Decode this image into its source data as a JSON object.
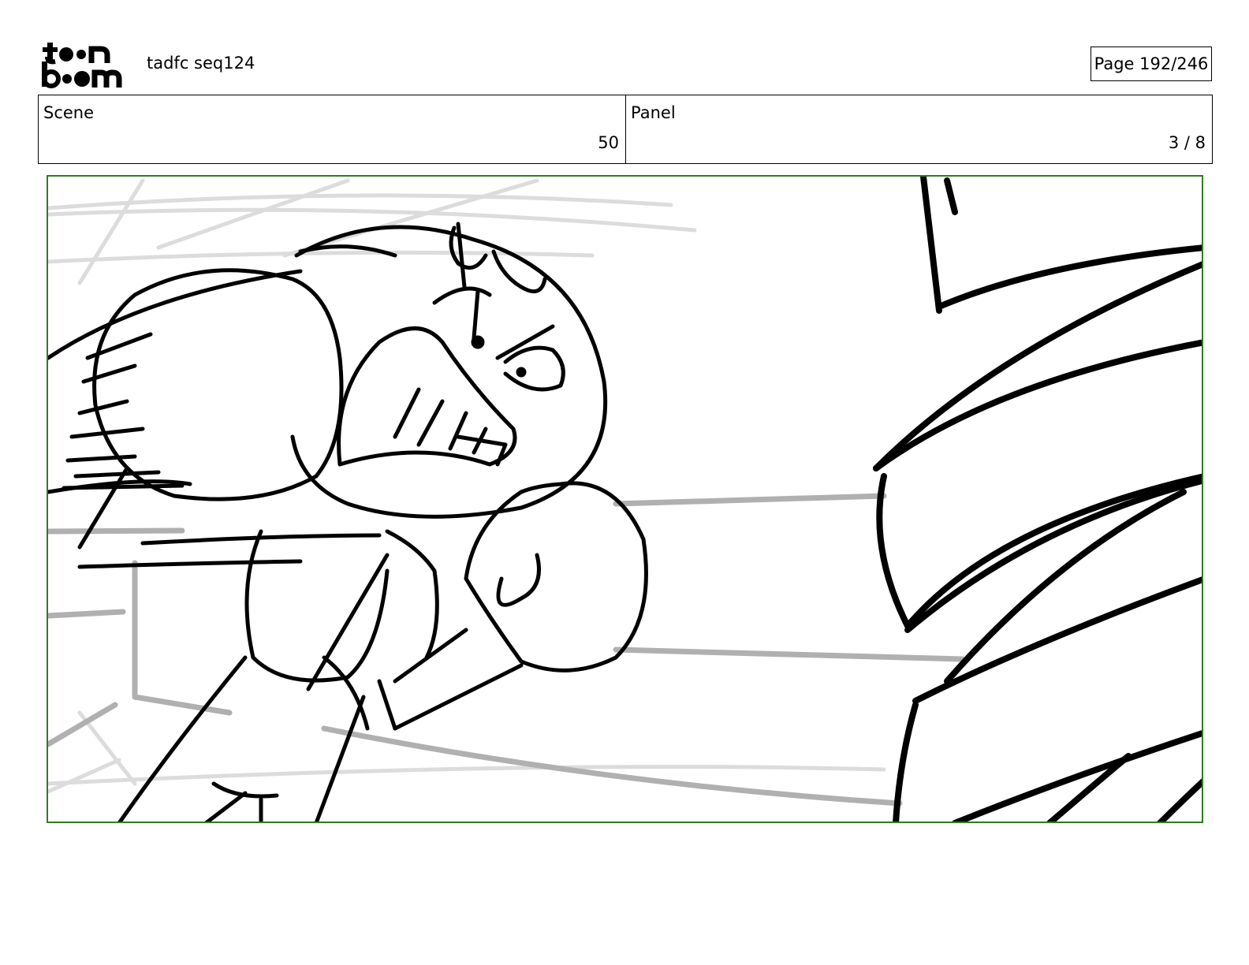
{
  "header": {
    "logo_text": "toon boom",
    "document_title": "tadfc seq124",
    "page_indicator": "Page 192/246"
  },
  "info": {
    "scene_label": "Scene",
    "scene_value": "50",
    "panel_label": "Panel",
    "panel_value": "3 / 8"
  },
  "colors": {
    "panel_border": "#2e7d1e",
    "sketch_line": "#000000",
    "background_line": "#b0b0b0"
  },
  "panel": {
    "content": "storyboard-sketch"
  }
}
